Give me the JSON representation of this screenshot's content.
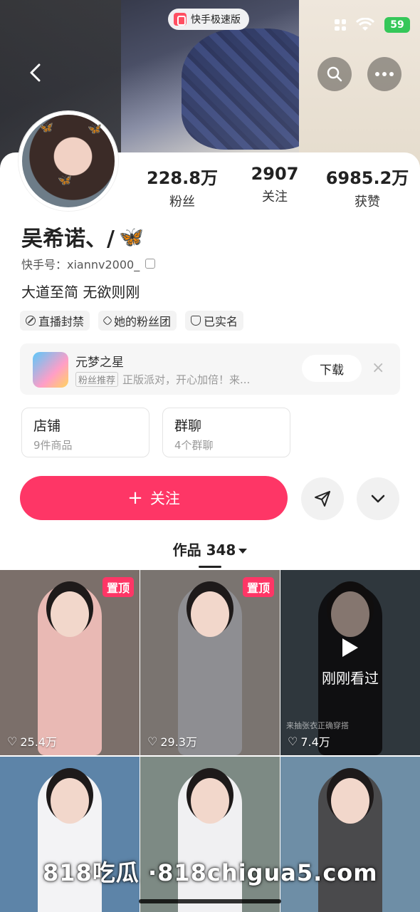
{
  "status_bar": {
    "app_pill_label": "快手极速版",
    "battery": "59"
  },
  "profile": {
    "stats": [
      {
        "value": "228.8万",
        "label": "粉丝"
      },
      {
        "value": "2907",
        "label": "关注"
      },
      {
        "value": "6985.2万",
        "label": "获赞"
      }
    ],
    "name": "吴希诺、/",
    "name_emoji": "🦋",
    "uid": "快手号：xiannv2000_",
    "bio": "大道至简 无欲则刚",
    "tags": [
      {
        "icon": "ban-icon",
        "label": "直播封禁"
      },
      {
        "icon": "fan-club-icon",
        "label": "她的粉丝团"
      },
      {
        "icon": "verified-shield-icon",
        "label": "已实名"
      }
    ]
  },
  "promo": {
    "title": "元梦之星",
    "badge": "粉丝推荐",
    "subtitle": "正版派对，开心加倍！来...",
    "download_label": "下载",
    "close_label": "×"
  },
  "boxes": {
    "shop": {
      "title": "店铺",
      "subtitle": "9件商品"
    },
    "group": {
      "title": "群聊",
      "subtitle": "4个群聊"
    }
  },
  "actions": {
    "follow_label": "关注",
    "follow_icon": "+"
  },
  "works": {
    "tab_label": "作品 348"
  },
  "grid": [
    {
      "pinned": "置顶",
      "likes": "25.4万",
      "bg": "#7b6f6a",
      "dress": "#e9b9b4"
    },
    {
      "pinned": "置顶",
      "likes": "29.3万",
      "bg": "#7a7470",
      "dress": "#8e8e92"
    },
    {
      "watched": "刚刚看过",
      "likes": "7.4万",
      "caption": "来抽张衣正确穿搭",
      "bg": "#56646f",
      "dress": "#1d1d1f"
    },
    {
      "bg": "#5d84a8",
      "dress": "#f3f3f5"
    },
    {
      "bg": "#7d8a84",
      "dress": "#f0f0f2"
    },
    {
      "bg": "#6e8ea6",
      "dress": "#4a4a4c"
    }
  ],
  "watermark": "818吃瓜 ·818chigua5.com",
  "colors": {
    "accent": "#fe3666",
    "battery": "#35c759"
  }
}
